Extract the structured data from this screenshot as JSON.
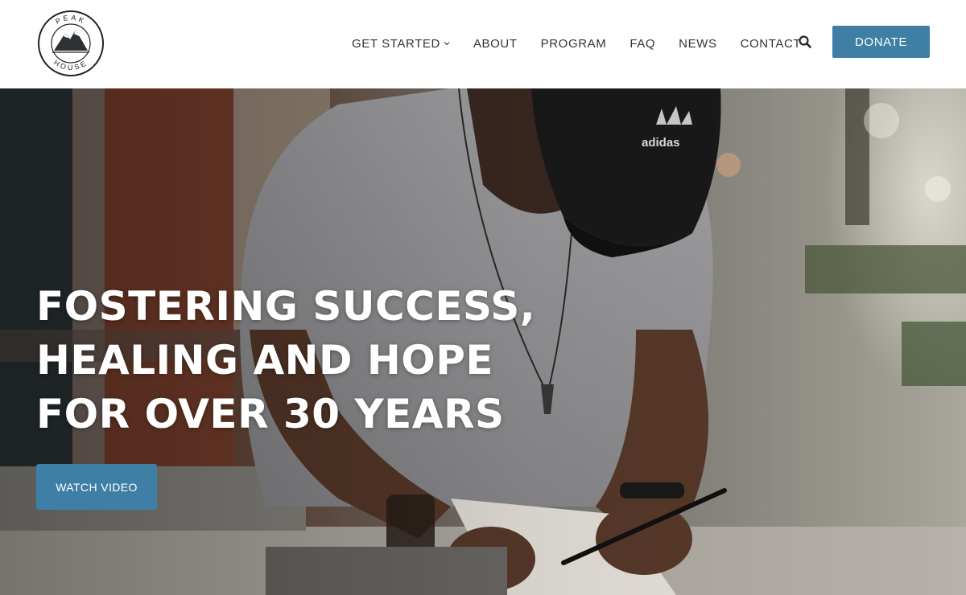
{
  "brand": {
    "logo_top_text": "PEAK",
    "logo_bottom_text": "HOUSE"
  },
  "nav": {
    "items": [
      {
        "label": "GET STARTED",
        "has_dropdown": true
      },
      {
        "label": "ABOUT"
      },
      {
        "label": "PROGRAM"
      },
      {
        "label": "FAQ"
      },
      {
        "label": "NEWS"
      },
      {
        "label": "CONTACT"
      }
    ],
    "search_icon": "search-icon",
    "donate_label": "DONATE"
  },
  "hero": {
    "title_lines": [
      "FOSTERING SUCCESS,",
      "HEALING AND HOPE",
      "FOR OVER 30 YEARS"
    ],
    "cta_label": "WATCH VIDEO",
    "cap_brand_text": "adidas"
  },
  "colors": {
    "accent": "#3f7fa5",
    "nav_text": "#333333",
    "hero_text": "#ffffff"
  }
}
